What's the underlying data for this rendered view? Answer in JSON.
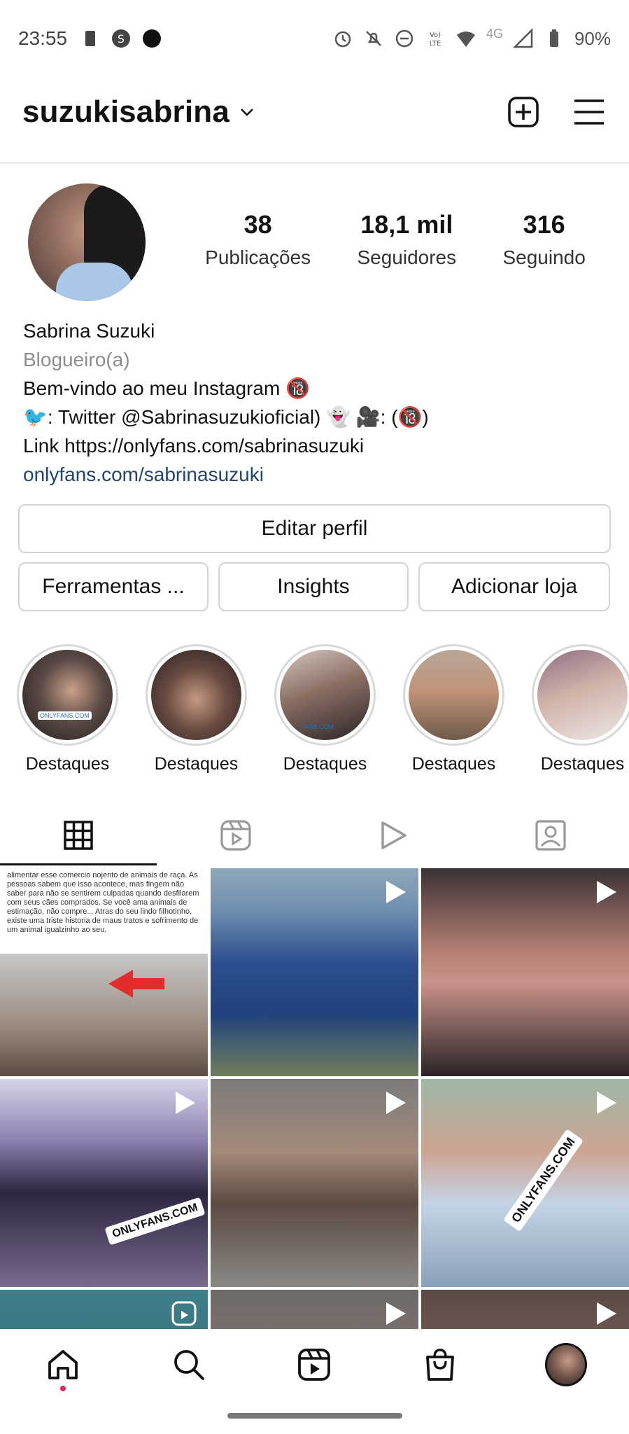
{
  "status_bar": {
    "time": "23:55",
    "battery": "90%",
    "network": "4G",
    "icons": [
      "sim-icon",
      "s-app-icon",
      "notification-dot-icon",
      "alarm-icon",
      "mute-icon",
      "dnd-icon",
      "volte-icon",
      "wifi-icon",
      "signal-icon",
      "battery-icon"
    ]
  },
  "header": {
    "username": "suzukisabrina",
    "icons": [
      "chevron-down-icon",
      "new-post-icon",
      "menu-icon"
    ]
  },
  "profile": {
    "stats": [
      {
        "value": "38",
        "label": "Publicações"
      },
      {
        "value": "18,1 mil",
        "label": "Seguidores"
      },
      {
        "value": "316",
        "label": "Seguindo"
      }
    ],
    "name": "Sabrina Suzuki",
    "category": "Blogueiro(a)",
    "bio_line1": "Bem-vindo ao meu Instagram 🔞",
    "bio_line2": "🐦: Twitter @Sabrinasuzukioficial) 👻 🎥: (🔞)",
    "bio_line3": "Link https://onlyfans.com/sabrinasuzuki",
    "website": "onlyfans.com/sabrinasuzuki"
  },
  "buttons": {
    "edit_profile": "Editar perfil",
    "tools": "Ferramentas ...",
    "insights": "Insights",
    "add_shop": "Adicionar loja"
  },
  "highlights": [
    {
      "label": "Destaques"
    },
    {
      "label": "Destaques"
    },
    {
      "label": "Destaques"
    },
    {
      "label": "Destaques"
    },
    {
      "label": "Destaques"
    }
  ],
  "tabs": [
    "grid-icon",
    "reels-icon",
    "video-icon",
    "tagged-icon"
  ],
  "grid_text": "alimentar esse comercio nojento de animais de raça. As pessoas sabem que isso acontece, mas fingem não saber para não se sentirem culpadas quando desfilarem com seus cães comprados. Se você ama animais de estimação, não compre... Atras do seu lindo filhotinho, existe uma triste historia de maus tratos e sofrimento de um animal igualzinho ao seu.",
  "grid_overlays": {
    "onlyfans_label_1": "ONLYFANS.COM",
    "onlyfans_label_2": "ONLYFANS.COM"
  },
  "highlight_overlays": {
    "onlyfans_small": "ONLYFANS.COM",
    "fans_small": "FANS.COM"
  },
  "bottom_nav": [
    "home-icon",
    "search-icon",
    "reels-icon",
    "shop-icon",
    "profile-avatar"
  ]
}
